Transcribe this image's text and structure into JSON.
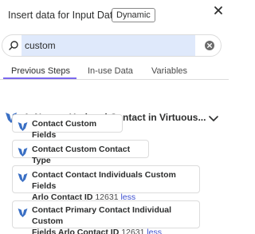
{
  "header": {
    "title": "Insert data for Input Data",
    "badge": "Dynamic"
  },
  "search": {
    "value": "custom",
    "placeholder": "Search"
  },
  "tabs": [
    {
      "label": "Previous Steps"
    },
    {
      "label": "In-use Data"
    },
    {
      "label": "Variables"
    }
  ],
  "step": {
    "title": "1.  New or Updated Contact in Virtuous..."
  },
  "fields": [
    {
      "label": "Contact Custom Fields"
    },
    {
      "label": "Contact Custom Contact Type"
    },
    {
      "label_line1": "Contact Contact Individuals Custom Fields",
      "label_line2": "Arlo Contact ID",
      "value": "12631",
      "toggle": "less"
    },
    {
      "label_line1": "Contact Primary Contact Individual Custom",
      "label_line2": "Fields Arlo Contact ID",
      "value": "12631",
      "toggle": "less"
    }
  ],
  "colors": {
    "accent": "#7b68ee",
    "app_icon": "#3a6fc4",
    "link": "#3d4fd0",
    "search_fill": "#dfe9fb"
  },
  "icons": {
    "close": "close-icon",
    "search": "search-icon",
    "clear": "clear-icon",
    "app": "virtuous-app-icon",
    "chevron": "chevron-down-icon"
  }
}
